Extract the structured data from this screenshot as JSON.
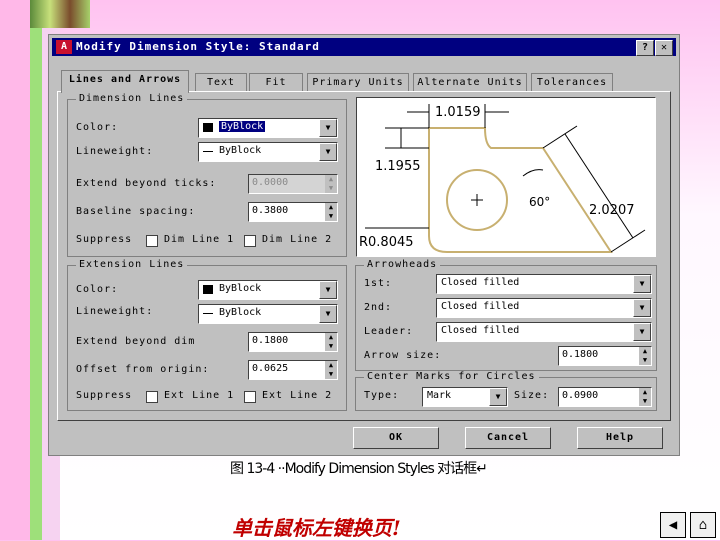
{
  "window": {
    "title": "Modify Dimension Style: Standard",
    "help_glyph": "?",
    "close_glyph": "✕"
  },
  "tabs": [
    "Lines and Arrows",
    "Text",
    "Fit",
    "Primary Units",
    "Alternate Units",
    "Tolerances"
  ],
  "dimension_lines": {
    "group_label": "Dimension Lines",
    "color_label": "Color:",
    "color_value": "ByBlock",
    "lineweight_label": "Lineweight:",
    "lineweight_value": "ByBlock",
    "extend_label": "Extend beyond ticks:",
    "extend_value": "0.0000",
    "baseline_label": "Baseline spacing:",
    "baseline_value": "0.3800",
    "suppress_label": "Suppress",
    "dim1_label": "Dim Line 1",
    "dim2_label": "Dim Line 2"
  },
  "extension_lines": {
    "group_label": "Extension Lines",
    "color_label": "Color:",
    "color_value": "ByBlock",
    "lineweight_label": "Lineweight:",
    "lineweight_value": "ByBlock",
    "extend_label": "Extend beyond dim",
    "extend_value": "0.1800",
    "offset_label": "Offset from origin:",
    "offset_value": "0.0625",
    "suppress_label": "Suppress",
    "ext1_label": "Ext Line 1",
    "ext2_label": "Ext Line 2"
  },
  "arrowheads": {
    "group_label": "Arrowheads",
    "first_label": "1st:",
    "first_value": "Closed filled",
    "second_label": "2nd:",
    "second_value": "Closed filled",
    "leader_label": "Leader:",
    "leader_value": "Closed filled",
    "size_label": "Arrow size:",
    "size_value": "0.1800"
  },
  "center_marks": {
    "group_label": "Center Marks for Circles",
    "type_label": "Type:",
    "type_value": "Mark",
    "size_label": "Size:",
    "size_value": "0.0900"
  },
  "preview": {
    "dim_top": "1.0159",
    "dim_left": "1.1955",
    "dim_right": "2.0207",
    "angle": "60°",
    "radius": "R0.8045"
  },
  "buttons": {
    "ok": "OK",
    "cancel": "Cancel",
    "help": "Help"
  },
  "caption": "图 13-4 ··Modify Dimension Styles 对话框↵",
  "footer": {
    "text": "单击鼠标左键换页!",
    "prev_glyph": "◀",
    "home_glyph": "⌂"
  },
  "colors": {
    "title_bar": "#000080",
    "footer_text": "#c00000",
    "preview_shape": "#c8b070"
  }
}
